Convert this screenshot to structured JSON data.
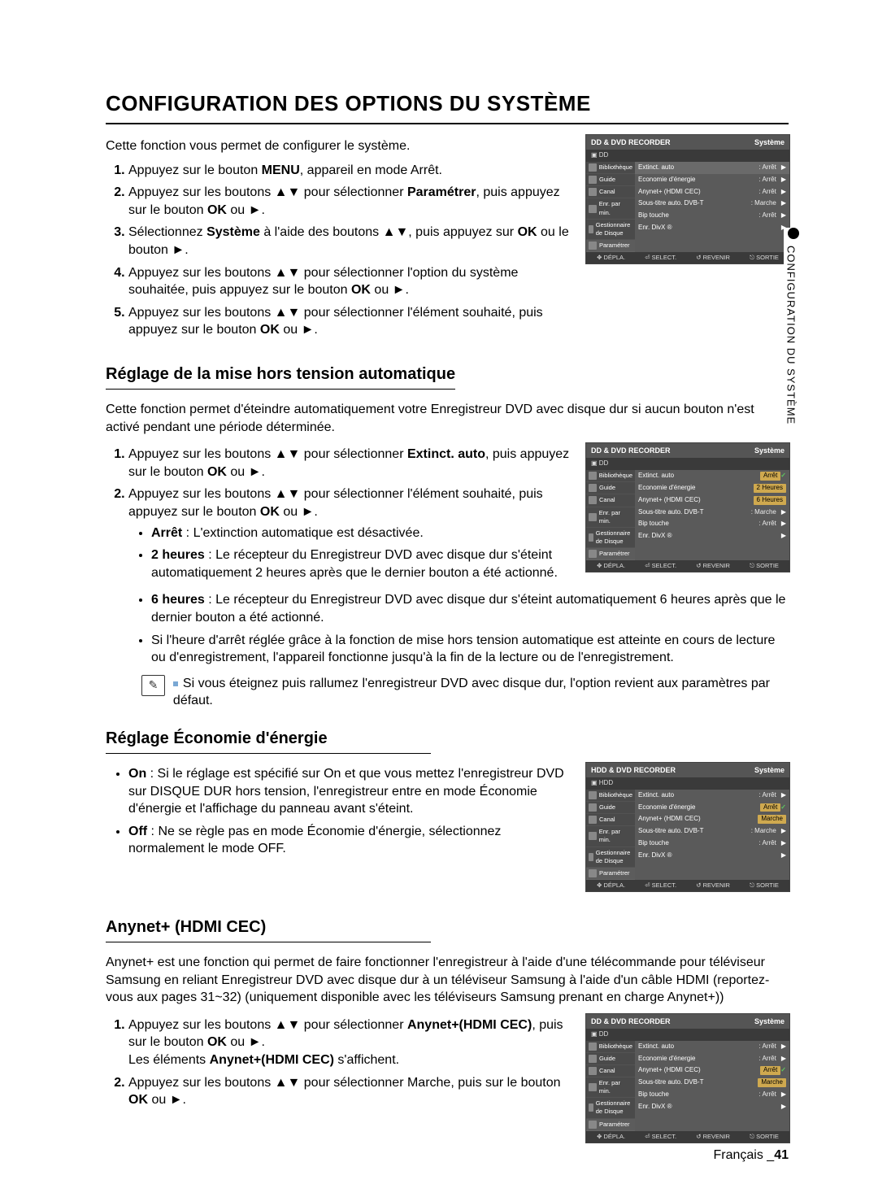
{
  "page": {
    "title": "CONFIGURATION DES OPTIONS DU SYSTÈME",
    "intro": "Cette fonction vous permet de configurer le système.",
    "footer_lang": "Français",
    "footer_page": "41",
    "sidetab": "CONFIGURATION DU SYSTÈME"
  },
  "main_steps": {
    "s1a": "Appuyez sur le bouton ",
    "s1b": "MENU",
    "s1c": ", appareil en mode Arrêt.",
    "s2a": "Appuyez sur les boutons ▲▼ pour sélectionner ",
    "s2b": "Paramétrer",
    "s2c": ", puis appuyez sur le bouton ",
    "s2d": "OK",
    "s2e": " ou ►.",
    "s3a": "Sélectionnez ",
    "s3b": "Système",
    "s3c": " à l'aide des boutons ▲▼, puis appuyez sur ",
    "s3d": "OK",
    "s3e": " ou le bouton ►.",
    "s4a": "Appuyez sur les boutons ▲▼ pour sélectionner l'option du système souhaitée, puis appuyez sur le bouton ",
    "s4b": "OK",
    "s4c": " ou ►.",
    "s5a": "Appuyez sur les boutons ▲▼ pour sélectionner l'élément souhaité, puis appuyez sur le bouton ",
    "s5b": "OK",
    "s5c": " ou ►."
  },
  "sec_auto": {
    "title": "Réglage de la mise hors tension automatique",
    "intro": "Cette fonction permet d'éteindre automatiquement votre Enregistreur DVD avec disque dur si aucun bouton n'est activé pendant une période déterminée.",
    "s1a": "Appuyez sur les boutons ▲▼ pour sélectionner ",
    "s1b": "Extinct. auto",
    "s1c": ", puis appuyez sur le bouton ",
    "s1d": "OK",
    "s1e": " ou ►.",
    "s2a": "Appuyez sur les boutons ▲▼ pour sélectionner l'élément souhaité, puis appuyez sur le bouton ",
    "s2b": "OK",
    "s2c": " ou ►.",
    "b1a": "Arrêt",
    "b1b": " : L'extinction automatique est désactivée.",
    "b2a": "2 heures",
    "b2b": " : Le récepteur du Enregistreur DVD avec disque dur s'éteint automatiquement 2 heures après que le dernier bouton a été actionné.",
    "b3a": "6 heures",
    "b3b": " : Le récepteur du Enregistreur DVD avec disque dur s'éteint automatiquement 6 heures après que le dernier bouton a été actionné.",
    "b4": "Si l'heure d'arrêt réglée grâce à la fonction de mise hors tension automatique est atteinte en cours de lecture ou d'enregistrement, l'appareil fonctionne jusqu'à la fin de la lecture ou de l'enregistrement.",
    "note": "Si vous éteignez puis rallumez l'enregistreur DVD avec disque dur, l'option revient aux paramètres par défaut."
  },
  "sec_eco": {
    "title": "Réglage Économie d'énergie",
    "b1a": "On",
    "b1b": " : Si le réglage est spécifié sur On et que vous mettez l'enregistreur DVD sur DISQUE DUR hors tension, l'enregistreur entre en mode Économie d'énergie et l'affichage du panneau avant s'éteint.",
    "b2a": "Off",
    "b2b": " : Ne se règle pas en mode Économie d'énergie, sélectionnez normalement le mode OFF."
  },
  "sec_anynet": {
    "title": "Anynet+ (HDMI CEC)",
    "intro": "Anynet+ est une fonction qui permet de faire fonctionner l'enregistreur à l'aide d'une télécommande pour téléviseur Samsung en reliant Enregistreur DVD avec disque dur à un téléviseur Samsung à l'aide d'un câble HDMI (reportez-vous aux pages 31~32) (uniquement disponible avec les téléviseurs Samsung prenant en charge Anynet+))",
    "s1a": "Appuyez sur les boutons ▲▼ pour sélectionner ",
    "s1b": "Anynet+(HDMI CEC)",
    "s1c": ", puis sur le bouton ",
    "s1d": "OK",
    "s1e": " ou ►.",
    "s1f": "Les éléments ",
    "s1g": "Anynet+(HDMI CEC)",
    "s1h": " s'affichent.",
    "s2a": "Appuyez sur les boutons ▲▼ pour sélectionner Marche, puis sur le bouton ",
    "s2b": "OK",
    "s2c": " ou ►."
  },
  "osd_common": {
    "title": "DD & DVD RECORDER",
    "title_hdd": "HDD & DVD RECORDER",
    "section": "Système",
    "sub": "▣ DD",
    "sub_hdd": "▣ HDD",
    "side": [
      "Bibliothèque",
      "Guide",
      "Canal",
      "Enr. par min.",
      "Gestionnaire de Disque",
      "Paramétrer"
    ],
    "foot": [
      "✥ DÉPLA.",
      "⏎ SELECT.",
      "↺ REVENIR",
      "⎋ SORTIE"
    ]
  },
  "osd1_rows": [
    {
      "k": "Extinct. auto",
      "v": ": Arrêt",
      "hl": false,
      "sel": true,
      "arrow": true
    },
    {
      "k": "Economie d'énergie",
      "v": ": Arrêt",
      "arrow": true
    },
    {
      "k": "Anynet+ (HDMI CEC)",
      "v": ": Arrêt",
      "arrow": true
    },
    {
      "k": "Sous-titre auto. DVB-T",
      "v": ": Marche",
      "arrow": true
    },
    {
      "k": "Bip touche",
      "v": ": Arrêt",
      "arrow": true
    },
    {
      "k": "Enr. DivX ®",
      "v": "",
      "arrow": true
    }
  ],
  "osd2_rows": [
    {
      "k": "Extinct. auto",
      "v": "Arrêt",
      "hl": true,
      "check": true
    },
    {
      "k": "Economie d'énergie",
      "v": "2 Heures",
      "hl": true
    },
    {
      "k": "Anynet+ (HDMI CEC)",
      "v": "6 Heures",
      "hl": true
    },
    {
      "k": "Sous-titre auto. DVB-T",
      "v": ": Marche",
      "arrow": true
    },
    {
      "k": "Bip touche",
      "v": ": Arrêt",
      "arrow": true
    },
    {
      "k": "Enr. DivX ®",
      "v": "",
      "arrow": true
    }
  ],
  "osd3_rows": [
    {
      "k": "Extinct. auto",
      "v": ": Arrêt",
      "arrow": true
    },
    {
      "k": "Economie d'énergie",
      "v": "Arrêt",
      "hl": true,
      "check": true
    },
    {
      "k": "Anynet+ (HDMI CEC)",
      "v": "Marche",
      "hl": true
    },
    {
      "k": "Sous-titre auto. DVB-T",
      "v": ": Marche",
      "arrow": true
    },
    {
      "k": "Bip touche",
      "v": ": Arrêt",
      "arrow": true
    },
    {
      "k": "Enr. DivX ®",
      "v": "",
      "arrow": true
    }
  ],
  "osd4_rows": [
    {
      "k": "Extinct. auto",
      "v": ": Arrêt",
      "arrow": true
    },
    {
      "k": "Economie d'énergie",
      "v": ": Arrêt",
      "arrow": true
    },
    {
      "k": "Anynet+ (HDMI CEC)",
      "v": "Arrêt",
      "hl": true,
      "check": true
    },
    {
      "k": "Sous-titre auto. DVB-T",
      "v": "Marche",
      "hl": true
    },
    {
      "k": "Bip touche",
      "v": ": Arrêt",
      "arrow": true
    },
    {
      "k": "Enr. DivX ®",
      "v": "",
      "arrow": true
    }
  ]
}
